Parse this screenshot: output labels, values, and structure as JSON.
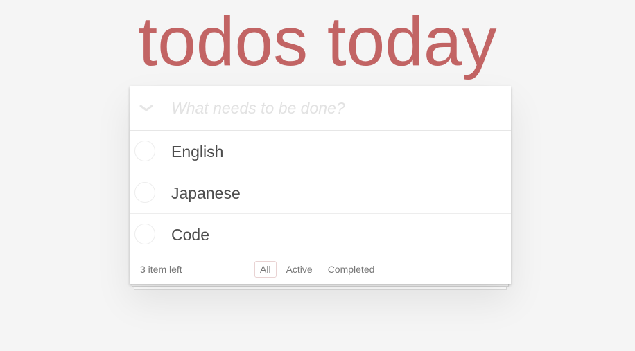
{
  "app": {
    "title": "todos today"
  },
  "new_todo": {
    "placeholder": "What needs to be done?",
    "value": "",
    "toggle_all_icon": "chevron-down-icon"
  },
  "todos": [
    {
      "label": "English",
      "completed": false
    },
    {
      "label": "Japanese",
      "completed": false
    },
    {
      "label": "Code",
      "completed": false
    }
  ],
  "footer": {
    "count_text": "3 item left",
    "filters": [
      {
        "label": "All",
        "selected": true
      },
      {
        "label": "Active",
        "selected": false
      },
      {
        "label": "Completed",
        "selected": false
      }
    ]
  },
  "colors": {
    "title": "#c26464",
    "background": "#f5f5f5",
    "text": "#4d4d4d",
    "placeholder": "#e2e2e2",
    "selected_filter_border": "#e9d3d3"
  }
}
